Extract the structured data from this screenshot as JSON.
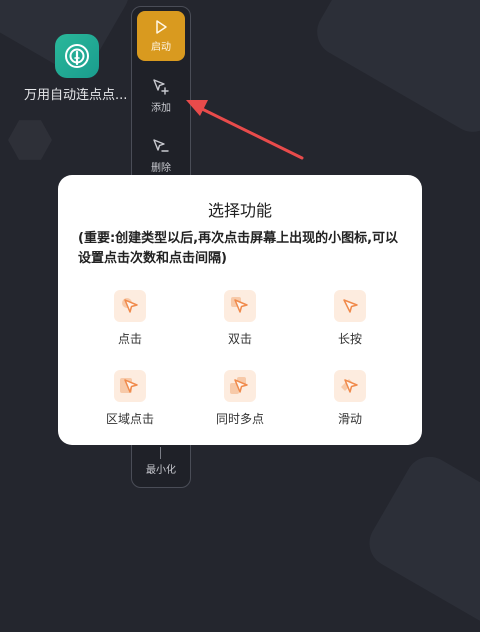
{
  "desktop": {
    "app_label": "万用自动连点点..."
  },
  "toolbar": {
    "start_label": "启动",
    "add_label": "添加",
    "delete_label": "删除",
    "minimize_label": "最小化"
  },
  "dialog": {
    "title": "选择功能",
    "note": "(重要:创建类型以后,再次点击屏幕上出现的小图标,可以设置点击次数和点击间隔)",
    "functions": [
      {
        "label": "点击",
        "icon": "tap-cursor-icon"
      },
      {
        "label": "双击",
        "icon": "double-tap-cursor-icon"
      },
      {
        "label": "长按",
        "icon": "long-press-cursor-icon"
      },
      {
        "label": "区域点击",
        "icon": "area-tap-cursor-icon"
      },
      {
        "label": "同时多点",
        "icon": "multi-point-cursor-icon"
      },
      {
        "label": "滑动",
        "icon": "swipe-cursor-icon"
      }
    ]
  },
  "colors": {
    "accent": "#d99a1f",
    "function_icon_bg": "#fdecdf",
    "function_icon_fg": "#f08a4b",
    "arrow": "#e84b4b",
    "background": "#24262e"
  }
}
